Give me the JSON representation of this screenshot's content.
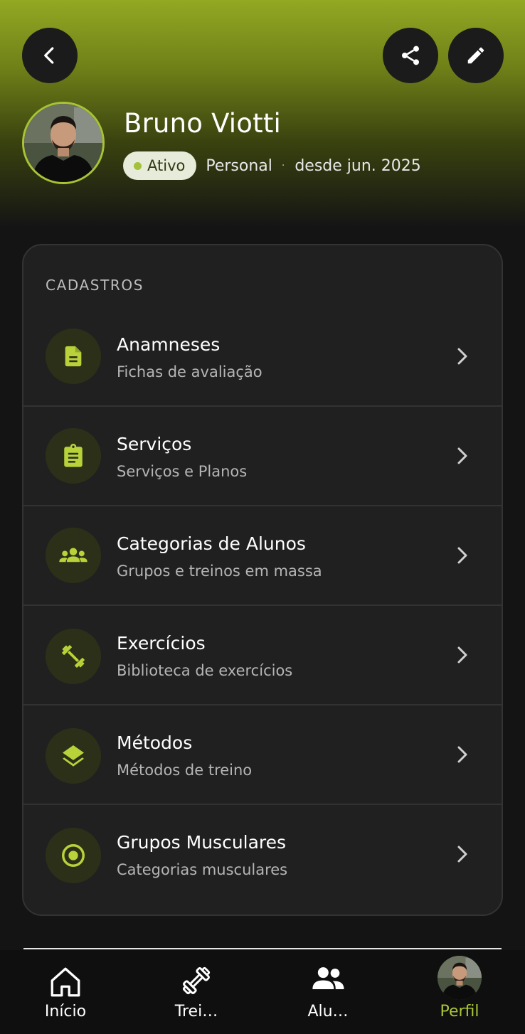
{
  "header": {
    "back_icon": "chevron-left-icon",
    "share_icon": "share-icon",
    "edit_icon": "pencil-icon"
  },
  "profile": {
    "name": "Bruno Viotti",
    "status": "Ativo",
    "role": "Personal",
    "separator": "·",
    "since": "desde jun. 2025"
  },
  "cadastros": {
    "title": "CADASTROS",
    "items": [
      {
        "icon": "document-icon",
        "title": "Anamneses",
        "subtitle": "Fichas de avaliação"
      },
      {
        "icon": "clipboard-icon",
        "title": "Serviços",
        "subtitle": "Serviços e Planos"
      },
      {
        "icon": "group-icon",
        "title": "Categorias de Alunos",
        "subtitle": "Grupos e treinos em massa"
      },
      {
        "icon": "dumbbell-icon",
        "title": "Exercícios",
        "subtitle": "Biblioteca de exercícios"
      },
      {
        "icon": "layers-icon",
        "title": "Métodos",
        "subtitle": "Métodos de treino"
      },
      {
        "icon": "target-icon",
        "title": "Grupos Musculares",
        "subtitle": "Categorias musculares"
      }
    ]
  },
  "bottom_nav": {
    "items": [
      {
        "icon": "home-icon",
        "label": "Início",
        "active": false
      },
      {
        "icon": "dumbbell-icon",
        "label": "Trei…",
        "active": false
      },
      {
        "icon": "people-icon",
        "label": "Alu…",
        "active": false
      },
      {
        "icon": "avatar",
        "label": "Perfil",
        "active": true
      }
    ]
  },
  "colors": {
    "accent": "#a9c637",
    "background": "#141414",
    "card": "#202020"
  }
}
